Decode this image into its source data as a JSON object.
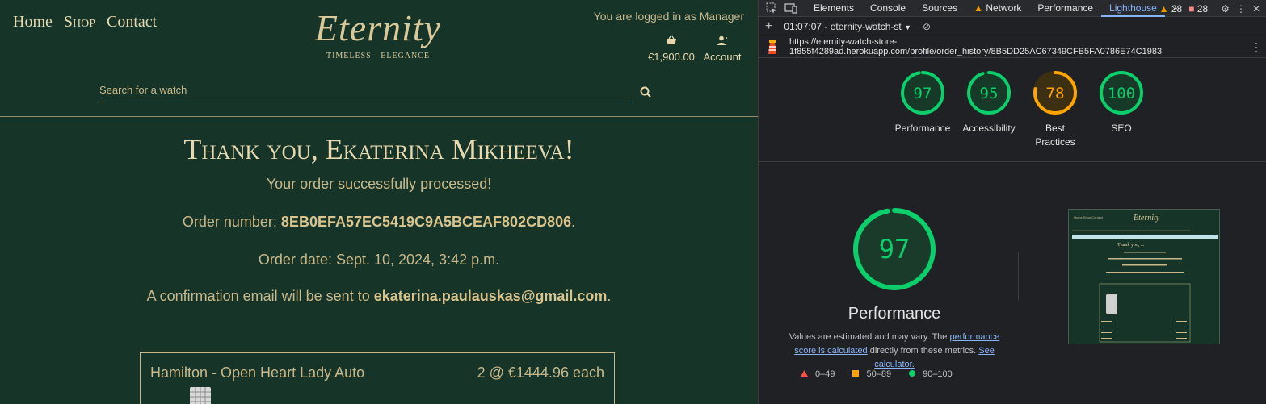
{
  "site": {
    "nav": [
      "Home",
      "Shop",
      "Contact"
    ],
    "logo": "Eternity",
    "tagline": "TIMELESS ELEGANCE",
    "logged_in": "You are logged in as Manager",
    "cart_total": "€1,900.00",
    "account_label": "Account",
    "search_placeholder": "Search for a watch",
    "thanks": "Thank you, Ekaterina Mikheeva!",
    "success": "Your order successfully processed!",
    "order_number_label": "Order number: ",
    "order_number": "8EB0EFA57EC5419C9A5BCEAF802CD806",
    "order_date": "Order date: Sept. 10, 2024, 3:42 p.m.",
    "email_prefix": "A confirmation email will be sent to ",
    "email": "ekaterina.paulauskas@gmail.com",
    "item_name": "Hamilton - Open Heart Lady Auto",
    "item_qty": "2 @ €1444.96 each"
  },
  "devtools": {
    "tabs": [
      "Elements",
      "Console",
      "Sources",
      "Network",
      "Performance",
      "Lighthouse"
    ],
    "active_tab": "Lighthouse",
    "warnings": "28",
    "errors": "28",
    "report_select": "01:07:07 - eternity-watch-st",
    "url": "https://eternity-watch-store-1f855f4289ad.herokuapp.com/profile/order_history/8B5DD25AC67349CFB5FA0786E74C1983",
    "scores": [
      {
        "label": "Performance",
        "value": 97,
        "color": "#0cce6b"
      },
      {
        "label": "Accessibility",
        "value": 95,
        "color": "#0cce6b"
      },
      {
        "label": "Best Practices",
        "value": 78,
        "color": "#ffa400"
      },
      {
        "label": "SEO",
        "value": 100,
        "color": "#0cce6b"
      }
    ],
    "main_score": 97,
    "main_label": "Performance",
    "desc_prefix": "Values are estimated and may vary. The ",
    "desc_link1": "performance score is calculated",
    "desc_mid": " directly from these metrics. ",
    "desc_link2": "See calculator.",
    "legend": [
      "0–49",
      "50–89",
      "90–100"
    ]
  }
}
